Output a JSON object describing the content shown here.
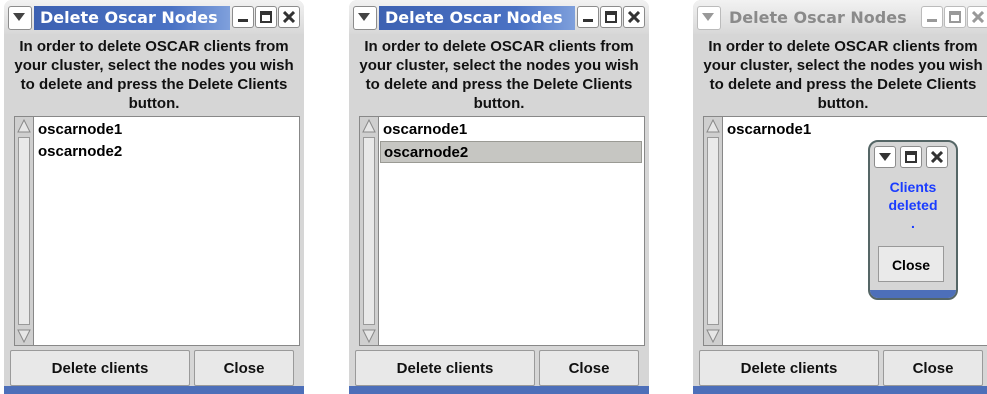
{
  "windows": [
    {
      "title": "Delete Oscar Nodes",
      "message": "In order to delete OSCAR clients from your cluster, select the nodes you wish to delete and press the Delete Clients button.",
      "items": [
        "oscarnode1",
        "oscarnode2"
      ],
      "selected_item": "none",
      "delete_label": "Delete clients",
      "close_label": "Close"
    },
    {
      "title": "Delete Oscar Nodes",
      "message": "In order to delete OSCAR clients from your cluster, select the nodes you wish to delete and press the Delete Clients button.",
      "items": [
        "oscarnode1",
        "oscarnode2"
      ],
      "selected_item": "oscarnode2",
      "delete_label": "Delete clients",
      "close_label": "Close"
    },
    {
      "title": "Delete Oscar Nodes",
      "message": "In order to delete OSCAR clients from your cluster, select the nodes you wish to delete and press the Delete Clients button.",
      "items": [
        "oscarnode1"
      ],
      "selected_item": "none",
      "delete_label": "Delete clients",
      "close_label": "Close"
    }
  ],
  "popup": {
    "message_line1": "Clients",
    "message_line2": "deleted",
    "message_line3": ".",
    "close_label": "Close"
  },
  "colors": {
    "title_active": "#4a72c4",
    "popup_text": "#1a3cff",
    "accent_strip": "#4d6fb9"
  },
  "icons": [
    "chevron-down-icon",
    "minimize-icon",
    "maximize-icon",
    "close-icon",
    "scroll-up-arrow-icon",
    "scroll-down-arrow-icon"
  ]
}
